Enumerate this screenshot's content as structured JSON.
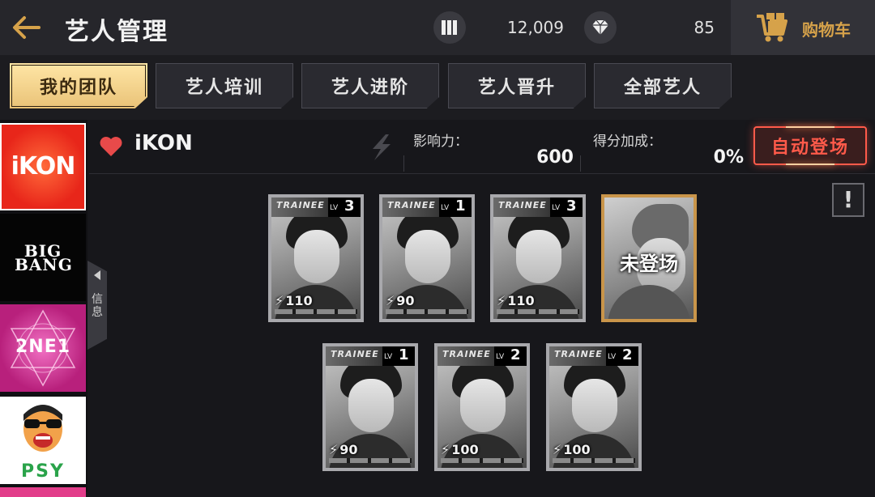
{
  "header": {
    "title": "艺人管理",
    "currency1_value": "12,009",
    "currency2_value": "85",
    "cart_label": "购物车",
    "icons": {
      "back": "back-arrow-icon",
      "currency1": "bars-icon",
      "currency2": "diamond-icon",
      "cart": "cart-icon"
    }
  },
  "tabs": [
    {
      "label": "我的团队",
      "active": true
    },
    {
      "label": "艺人培训",
      "active": false
    },
    {
      "label": "艺人进阶",
      "active": false
    },
    {
      "label": "艺人晋升",
      "active": false
    },
    {
      "label": "全部艺人",
      "active": false
    }
  ],
  "sidebar": {
    "groups": [
      {
        "name": "iKON",
        "selected": true
      },
      {
        "name": "BIG BANG",
        "selected": false
      },
      {
        "name": "2NE1",
        "selected": false
      },
      {
        "name": "PSY",
        "selected": false
      }
    ],
    "collapse_label": "信息"
  },
  "group": {
    "name": "iKON",
    "influence_label": "影响力：",
    "influence_value": "600",
    "bonus_label": "得分加成：",
    "bonus_value": "0%",
    "auto_button": "自动登场",
    "info_button": "!"
  },
  "cards_row1": [
    {
      "badge": "TRAINEE",
      "lv_label": "LV",
      "level": "3",
      "power": "110"
    },
    {
      "badge": "TRAINEE",
      "lv_label": "LV",
      "level": "1",
      "power": "90"
    },
    {
      "badge": "TRAINEE",
      "lv_label": "LV",
      "level": "3",
      "power": "110"
    }
  ],
  "empty_slot": {
    "label": "未登场"
  },
  "cards_row2": [
    {
      "badge": "TRAINEE",
      "lv_label": "LV",
      "level": "1",
      "power": "90"
    },
    {
      "badge": "TRAINEE",
      "lv_label": "LV",
      "level": "2",
      "power": "100"
    },
    {
      "badge": "TRAINEE",
      "lv_label": "LV",
      "level": "2",
      "power": "100"
    }
  ],
  "colors": {
    "accent_gold": "#d6a24a",
    "auto_red": "#ff5a4a",
    "heart_red": "#e84a4a",
    "background": "#17171b"
  }
}
